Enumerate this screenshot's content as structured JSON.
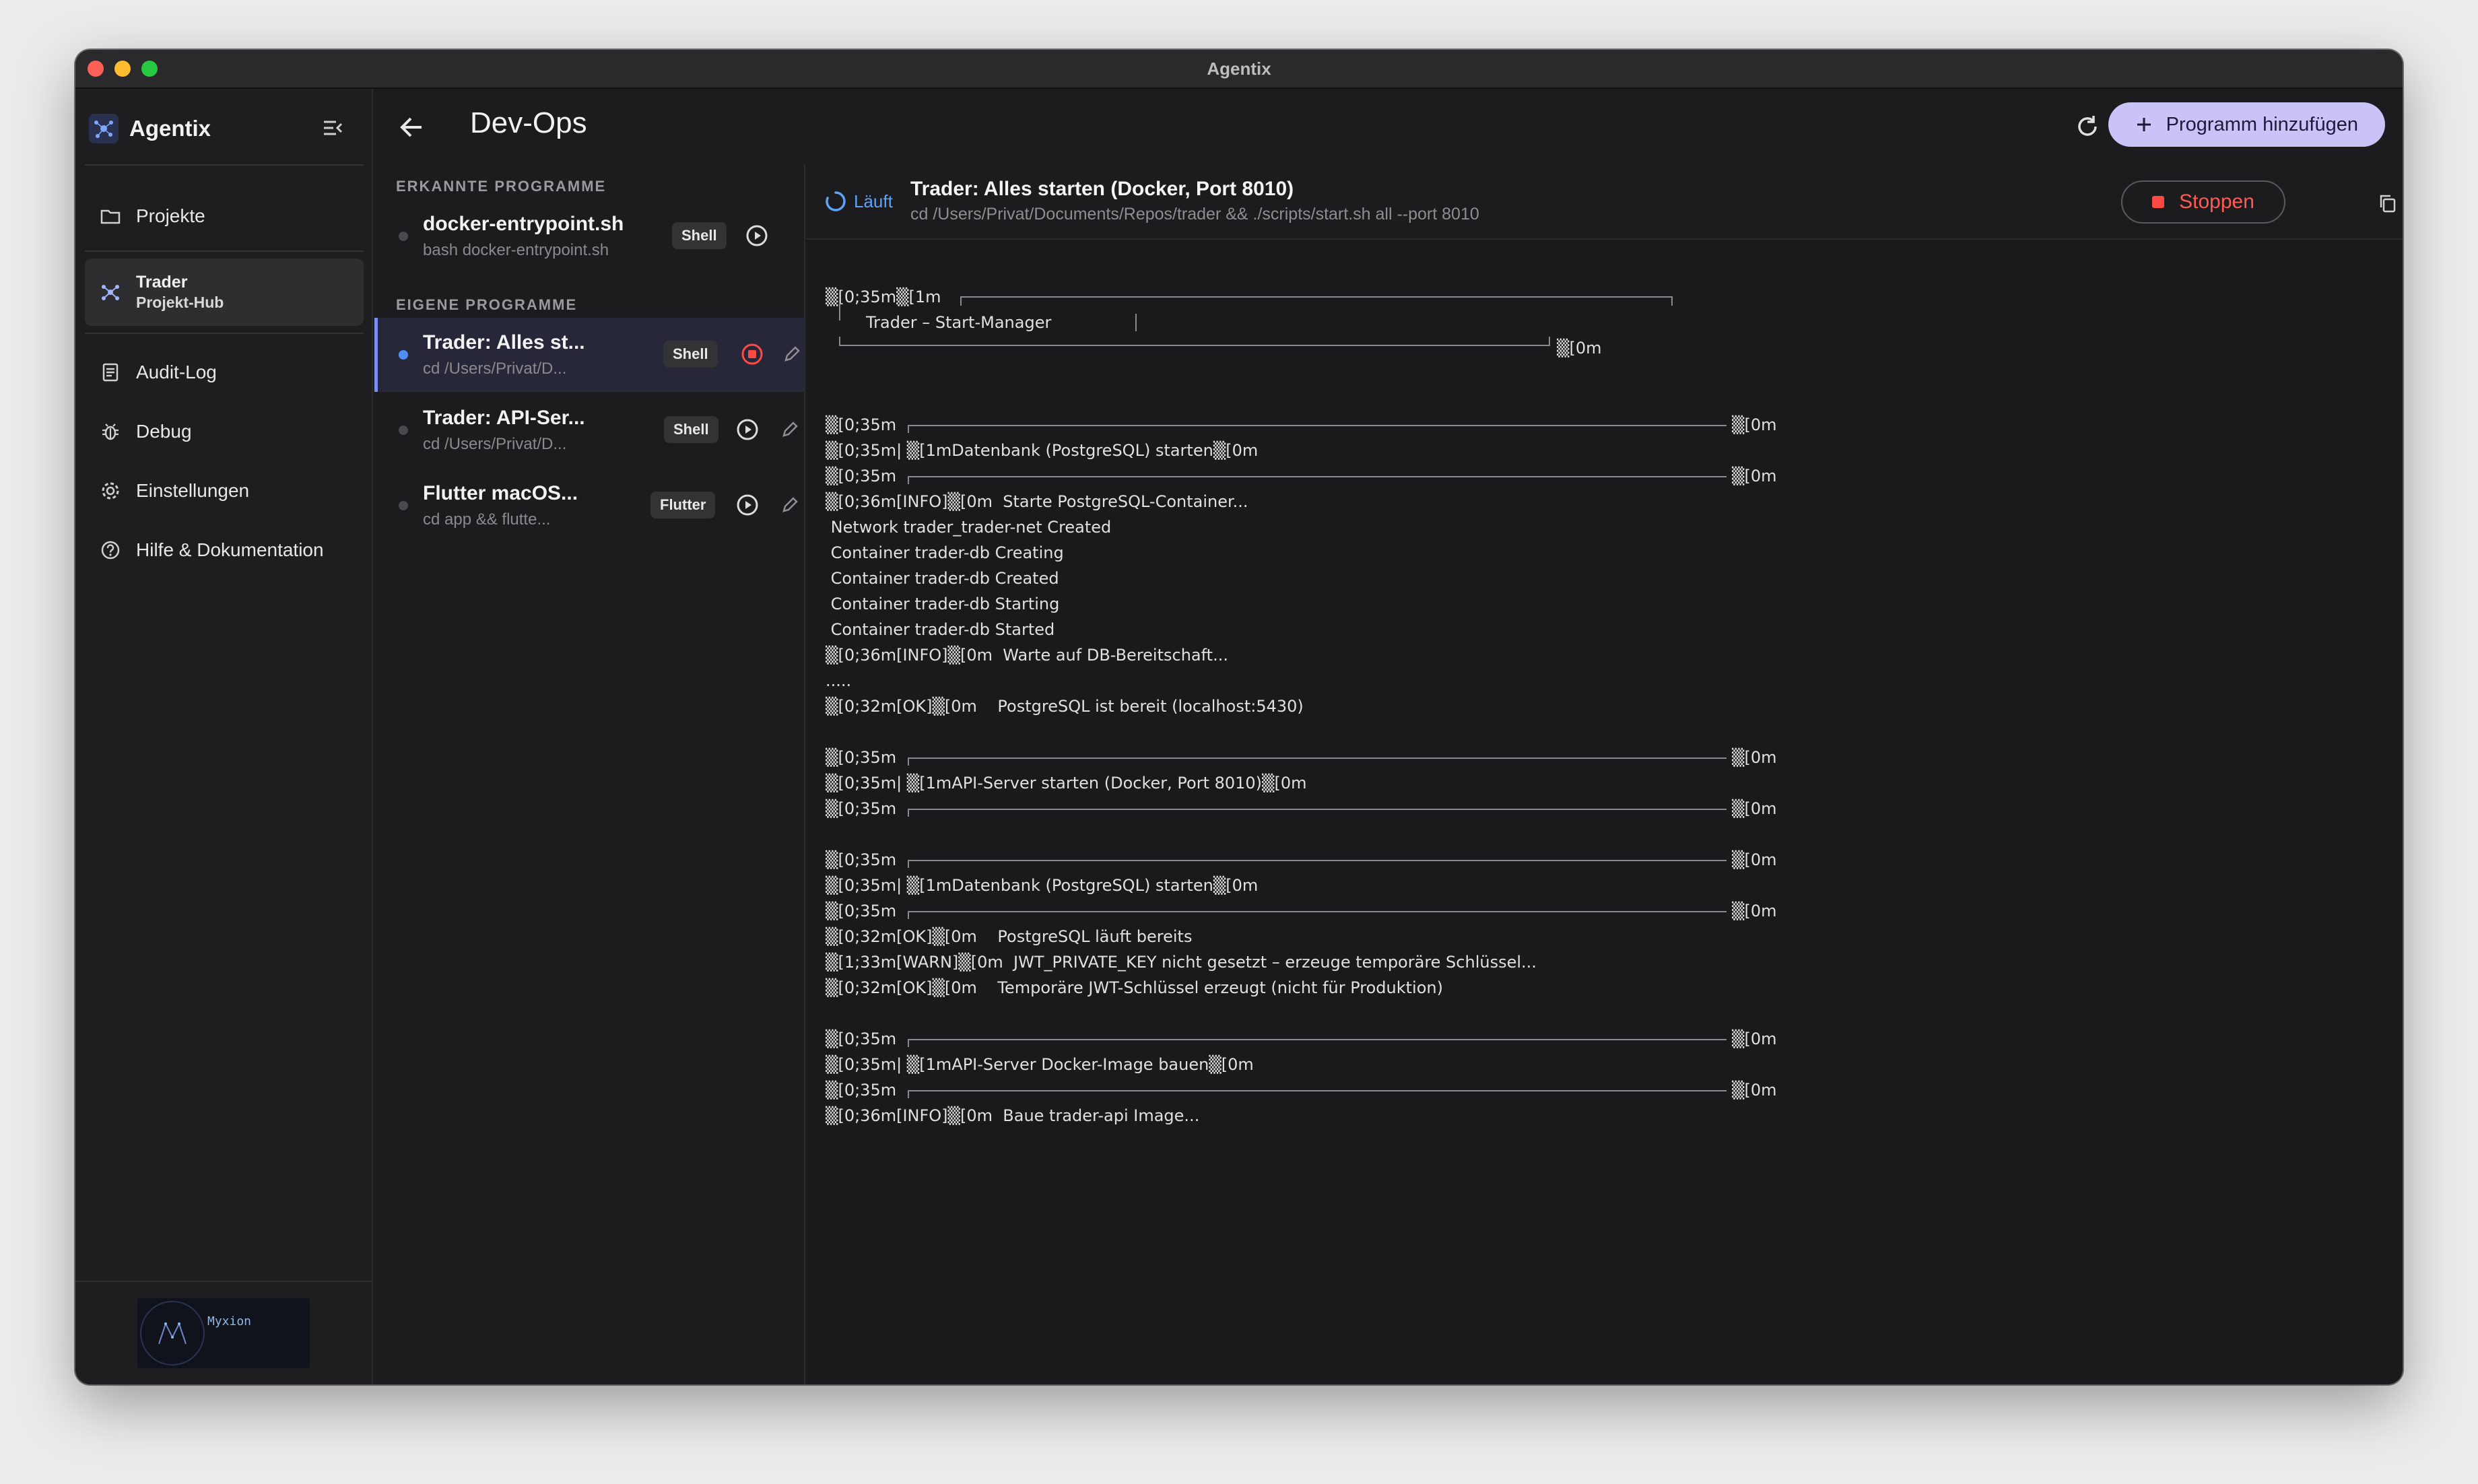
{
  "window": {
    "title": "Agentix"
  },
  "sidebar": {
    "brand": "Agentix",
    "items": [
      {
        "label": "Projekte"
      },
      {
        "label": "Trader",
        "sublabel": "Projekt-Hub"
      },
      {
        "label": "Audit-Log"
      },
      {
        "label": "Debug"
      },
      {
        "label": "Einstellungen"
      },
      {
        "label": "Hilfe & Dokumentation"
      }
    ],
    "footer_logo_text": "Myxion"
  },
  "header": {
    "title": "Dev-Ops",
    "add_button": "Programm hinzufügen"
  },
  "programs": {
    "detected_title": "ERKANNTE PROGRAMME",
    "own_title": "EIGENE PROGRAMME",
    "detected": [
      {
        "name": "docker-entrypoint.sh",
        "cmd": "bash docker-entrypoint.sh",
        "badge": "Shell"
      }
    ],
    "own": [
      {
        "name": "Trader: Alles st...",
        "cmd": "cd /Users/Privat/D...",
        "badge": "Shell"
      },
      {
        "name": "Trader: API-Ser...",
        "cmd": "cd /Users/Privat/D...",
        "badge": "Shell"
      },
      {
        "name": "Flutter macOS...",
        "cmd": "cd app && flutte...",
        "badge": "Flutter"
      }
    ]
  },
  "detail": {
    "status": "Läuft",
    "title": "Trader: Alles starten (Docker, Port 8010)",
    "cmd": "cd /Users/Privat/Documents/Repos/trader && ./scripts/start.sh all --port 8010",
    "stop_button": "Stoppen"
  },
  "log": {
    "banner_start": "▒[0;35m▒[1m",
    "banner_title": "Trader – Start-Manager",
    "banner_end": "▒[0m",
    "lines": [
      "▒[0;35m",
      "▒[0;35m| ▒[1mDatenbank (PostgreSQL) starten▒[0m",
      "▒[0;35m",
      "▒[0;36m[INFO]▒[0m  Starte PostgreSQL-Container...",
      " Network trader_trader-net Created",
      " Container trader-db Creating",
      " Container trader-db Created",
      " Container trader-db Starting",
      " Container trader-db Started",
      "▒[0;36m[INFO]▒[0m  Warte auf DB-Bereitschaft...",
      ".....",
      "▒[0;32m[OK]▒[0m    PostgreSQL ist bereit (localhost:5430)",
      "▒[0;35m",
      "▒[0;35m| ▒[1mAPI-Server starten (Docker, Port 8010)▒[0m",
      "▒[0;35m",
      "▒[0;35m",
      "▒[0;35m| ▒[1mDatenbank (PostgreSQL) starten▒[0m",
      "▒[0;35m",
      "▒[0;32m[OK]▒[0m    PostgreSQL läuft bereits",
      "▒[1;33m[WARN]▒[0m  JWT_PRIVATE_KEY nicht gesetzt – erzeuge temporäre Schlüssel...",
      "▒[0;32m[OK]▒[0m    Temporäre JWT-Schlüssel erzeugt (nicht für Produktion)",
      "▒[0;35m",
      "▒[0;35m| ▒[1mAPI-Server Docker-Image bauen▒[0m",
      "▒[0;35m",
      "▒[0;36m[INFO]▒[0m  Baue trader-api Image..."
    ],
    "rule_end": "▒[0m"
  },
  "colors": {
    "accent": "#c9c3f7",
    "running": "#5fa3f6",
    "stop": "#ff5a54",
    "active_dot": "#4f8ef7"
  }
}
